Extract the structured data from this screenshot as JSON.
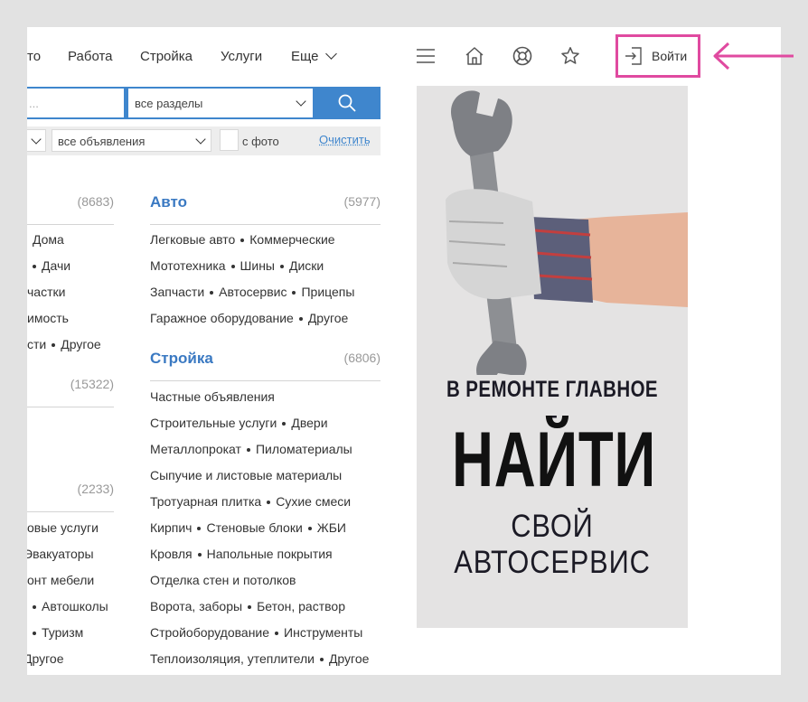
{
  "nav": {
    "items": [
      "то",
      "Работа",
      "Стройка",
      "Услуги",
      "Еще"
    ],
    "login_label": "Войти"
  },
  "search": {
    "input_text": "...",
    "section_value": "все разделы"
  },
  "filters": {
    "type_value": "все объявления",
    "photo_label": "с фото",
    "clear_label": "Очистить"
  },
  "left_column": {
    "counts": [
      "(8683)",
      "(15322)",
      "(2233)"
    ],
    "lines_group1": [
      [
        "Дома"
      ],
      [
        "",
        "Дачи"
      ],
      [
        "частки"
      ],
      [
        "имость"
      ],
      [
        "сти",
        "Другое"
      ]
    ],
    "lines_group3": [
      [
        "овые услуги"
      ],
      [
        "Эвакуаторы"
      ],
      [
        "онт мебели"
      ],
      [
        "",
        "Автошколы"
      ],
      [
        "",
        "Туризм"
      ],
      [
        "Другое"
      ]
    ]
  },
  "auto": {
    "title": "Авто",
    "count": "(5977)",
    "lines": [
      [
        "Легковые авто",
        "Коммерческие"
      ],
      [
        "Мототехника",
        "Шины",
        "Диски"
      ],
      [
        "Запчасти",
        "Автосервис",
        "Прицепы"
      ],
      [
        "Гаражное оборудование",
        "Другое"
      ]
    ]
  },
  "stroyka": {
    "title": "Стройка",
    "count": "(6806)",
    "lines": [
      [
        "Частные объявления"
      ],
      [
        "Строительные услуги",
        "Двери"
      ],
      [
        "Металлопрокат",
        "Пиломатериалы"
      ],
      [
        "Сыпучие и листовые материалы"
      ],
      [
        "Тротуарная плитка",
        "Сухие смеси"
      ],
      [
        "Кирпич",
        "Стеновые блоки",
        "ЖБИ"
      ],
      [
        "Кровля",
        "Напольные покрытия"
      ],
      [
        "Отделка стен и потолков"
      ],
      [
        "Ворота, заборы",
        "Бетон, раствор"
      ],
      [
        "Стройоборудование",
        "Инструменты"
      ],
      [
        "Теплоизоляция, утеплители",
        "Другое"
      ]
    ]
  },
  "banner": {
    "line1": "В РЕМОНТЕ ГЛАВНОЕ –",
    "line2": "НАЙТИ",
    "line3": "СВОЙ",
    "line4": "АВТОСЕРВИС"
  },
  "colors": {
    "accent": "#3f86cd",
    "highlight": "#e04aa0",
    "category_title": "#3a79c2"
  }
}
